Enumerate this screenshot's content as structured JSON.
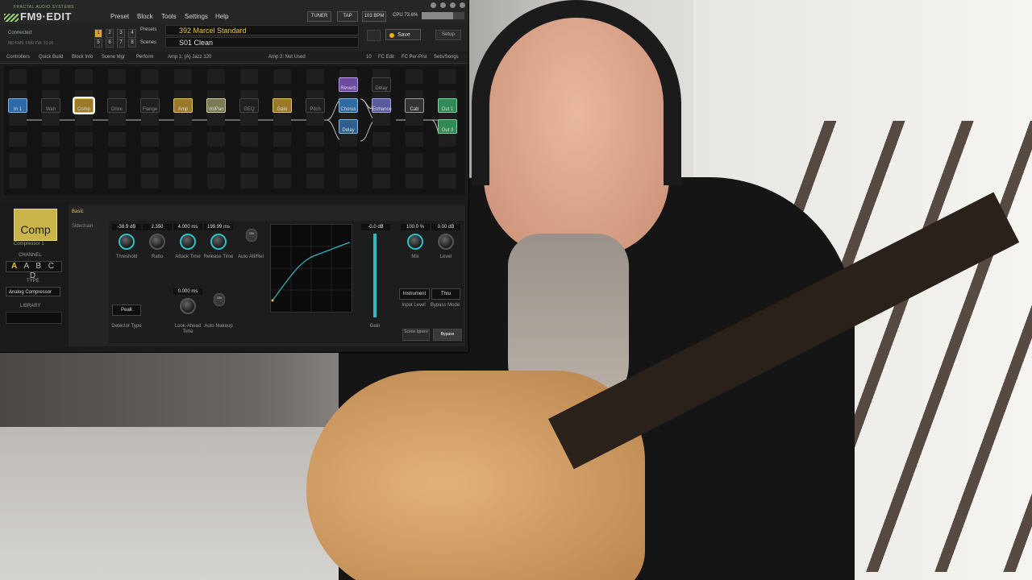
{
  "app": {
    "logo_sub": "FRACTAL AUDIO SYSTEMS",
    "logo_main": "FM9·EDIT",
    "menu": [
      "Preset",
      "Block",
      "Tools",
      "Settings",
      "Help"
    ],
    "tuner": "TUNER",
    "tap": "TAP",
    "bpm": "103 BPM",
    "cpu_label": "CPU 73.6%",
    "cpu_fraction": 0.736
  },
  "header": {
    "connected": "Connected:",
    "device_info": "MD:FM9: FM9 FW: 10.00",
    "preset_numbers": [
      "1",
      "2",
      "3",
      "4",
      "5",
      "6",
      "7",
      "8"
    ],
    "selected_number": "1",
    "presets_label": "Presets",
    "scenes_label": "Scenes",
    "preset_name": "392  Marcel Standard",
    "scene_name": "S01  Clean",
    "save_label": "Save",
    "setup_label": "Setup",
    "save_dot_color": "#f0b000"
  },
  "tabs": [
    "Controllers",
    "Quick Build",
    "Block Info",
    "Scene Mgr",
    "Perform"
  ],
  "amp_info": {
    "amp1": "Amp 1: (A) Jazz 120",
    "amp2": "Amp 2: Not Used",
    "count": "10",
    "fc_edit": "FC Edit",
    "fc_per_prst": "FC Per-Prst",
    "sets_songs": "Sets/Songs"
  },
  "blocks": {
    "in1": "In 1",
    "wah": "Wah",
    "comp": "Comp",
    "drive": "Drive",
    "flange": "Flange",
    "amp": "Amp",
    "volpan": "VolPan",
    "geq": "GEQ",
    "gate": "Gate",
    "pitch": "Pitch",
    "reverb": "Reverb",
    "chorus": "Chorus",
    "delay": "Delay",
    "delay_top": "Delay",
    "enhance": "Enhance",
    "cab": "Cab",
    "out1": "Out 1",
    "out3": "Out 3"
  },
  "block_editor": {
    "block_title": "Comp",
    "block_subtitle": "Compressor 1",
    "channel_label": "CHANNEL",
    "channels": "A B C D",
    "selected_channel": "A",
    "type_label": "TYPE",
    "type_value": "Analog Compressor",
    "library_label": "LIBRARY",
    "tab_basic": "Basic",
    "tab_sidechain": "Sidechain",
    "threshold": {
      "value": "-38.9 dB",
      "label": "Threshold"
    },
    "ratio": {
      "value": "2.350",
      "label": "Ratio"
    },
    "attack": {
      "value": "4.000 ms",
      "label": "Attack Time"
    },
    "release": {
      "value": "199.99 ms",
      "label": "Release Time"
    },
    "auto_att_rel": {
      "value": "ON",
      "label": "Auto Att/Rel"
    },
    "detector": {
      "value": "Peak",
      "label": "Detector Type"
    },
    "lookahead": {
      "value": "0.000 ms",
      "label": "Look-Ahead Time"
    },
    "auto_makeup": {
      "value": "ON",
      "label": "Auto Makeup"
    },
    "gain": {
      "value": "-0.0 dB",
      "label": "Gain"
    },
    "mix": {
      "value": "100.0 %",
      "label": "Mix"
    },
    "level": {
      "value": "0.00 dB",
      "label": "Level"
    },
    "input_level": {
      "value": "Instrument",
      "label": "Input Level"
    },
    "bypass_mode": {
      "value": "Thru",
      "label": "Bypass Mode"
    },
    "scene_ignore": "Scene Ignore",
    "bypass": "Bypass",
    "accent_color": "#2fc1c9"
  }
}
